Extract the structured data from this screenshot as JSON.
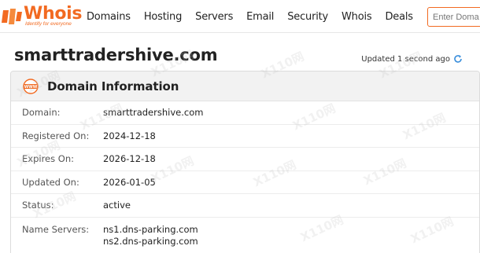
{
  "brand": {
    "name": "Whois",
    "tagline": "Identify for everyone",
    "color": "#f26a21"
  },
  "nav": [
    "Domains",
    "Hosting",
    "Servers",
    "Email",
    "Security",
    "Whois",
    "Deals"
  ],
  "search": {
    "placeholder": "Enter Doma"
  },
  "page": {
    "title": "smarttradershive.com",
    "updated": "Updated 1 second ago"
  },
  "card": {
    "title": "Domain Information",
    "rows": [
      {
        "label": "Domain:",
        "value": "smarttradershive.com"
      },
      {
        "label": "Registered On:",
        "value": "2024-12-18"
      },
      {
        "label": "Expires On:",
        "value": "2026-12-18"
      },
      {
        "label": "Updated On:",
        "value": "2026-01-05"
      },
      {
        "label": "Status:",
        "value": "active"
      }
    ],
    "name_servers": {
      "label": "Name Servers:",
      "values": [
        "ns1.dns-parking.com",
        "ns2.dns-parking.com"
      ]
    }
  },
  "watermark": "X110网",
  "icons": {
    "refresh": "refresh-icon",
    "www": "www-icon",
    "logo": "logo-mark-icon"
  },
  "colors": {
    "accent": "#f26a21",
    "refresh": "#3b8fdc"
  }
}
